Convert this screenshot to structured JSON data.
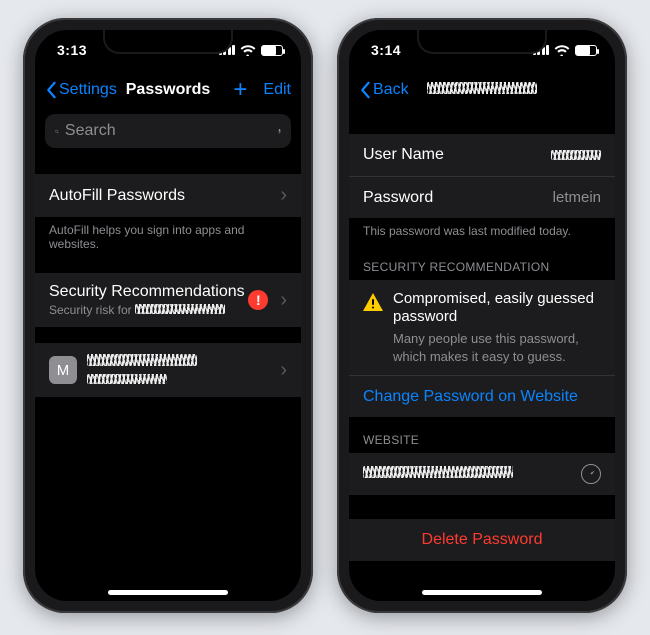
{
  "colors": {
    "accent": "#0a84ff",
    "danger": "#ff3b30",
    "warn": "#ffcc00"
  },
  "left": {
    "status": {
      "time": "3:13"
    },
    "nav": {
      "back": "Settings",
      "title": "Passwords",
      "edit": "Edit"
    },
    "search": {
      "placeholder": "Search"
    },
    "autofill": {
      "label": "AutoFill Passwords"
    },
    "autofill_note": "AutoFill helps you sign into apps and websites.",
    "security": {
      "title": "Security Recommendations",
      "subtitle_prefix": "Security risk for "
    },
    "entry": {
      "initial": "M"
    }
  },
  "right": {
    "status": {
      "time": "3:14"
    },
    "nav": {
      "back": "Back"
    },
    "rows": {
      "username_label": "User Name",
      "password_label": "Password",
      "password_value": "letmein"
    },
    "modified_note": "This password was last modified today.",
    "section_header": "SECURITY RECOMMENDATION",
    "warn_title": "Compromised, easily guessed password",
    "warn_body": "Many people use this password, which makes it easy to guess.",
    "change_link": "Change Password on Website",
    "website_header": "WEBSITE",
    "delete": "Delete Password"
  }
}
